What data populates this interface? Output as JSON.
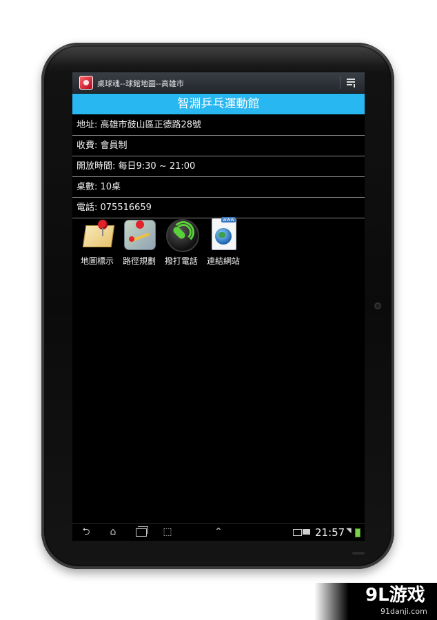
{
  "app": {
    "title": "桌球魂--球館地圖--高雄市",
    "icons": {
      "app": "app-logo-icon",
      "overflow": "overflow-menu-icon"
    }
  },
  "venue": {
    "name": "智淵乒乓運動館",
    "rows": [
      {
        "key": "address",
        "text": "地址: 高雄市鼓山區正德路28號"
      },
      {
        "key": "fee",
        "text": "收費: 會員制"
      },
      {
        "key": "hours",
        "text": "開放時間: 每日9:30 ~ 21:00"
      },
      {
        "key": "tables",
        "text": "桌數: 10桌"
      },
      {
        "key": "phone",
        "text": "電話: 075516659"
      }
    ]
  },
  "actions": [
    {
      "label": "地圖標示",
      "icon": "map-pin-icon"
    },
    {
      "label": "路徑規劃",
      "icon": "route-map-icon"
    },
    {
      "label": "撥打電話",
      "icon": "phone-call-icon"
    },
    {
      "label": "連結網站",
      "icon": "web-globe-icon"
    }
  ],
  "navbar": {
    "buttons": [
      "back-icon",
      "home-icon",
      "recent-apps-icon",
      "screenshot-icon",
      "chevron-up-icon"
    ]
  },
  "status": {
    "time": "21:57",
    "icons": [
      "picture-notification-icon",
      "keyboard-icon",
      "wifi-icon",
      "battery-icon"
    ]
  },
  "watermark": {
    "logo": "9L游戏",
    "url": "91danji.com"
  },
  "colors": {
    "title_band": "#29b7f2",
    "battery": "#7bd24a",
    "phone_green": "#5ad13a"
  }
}
